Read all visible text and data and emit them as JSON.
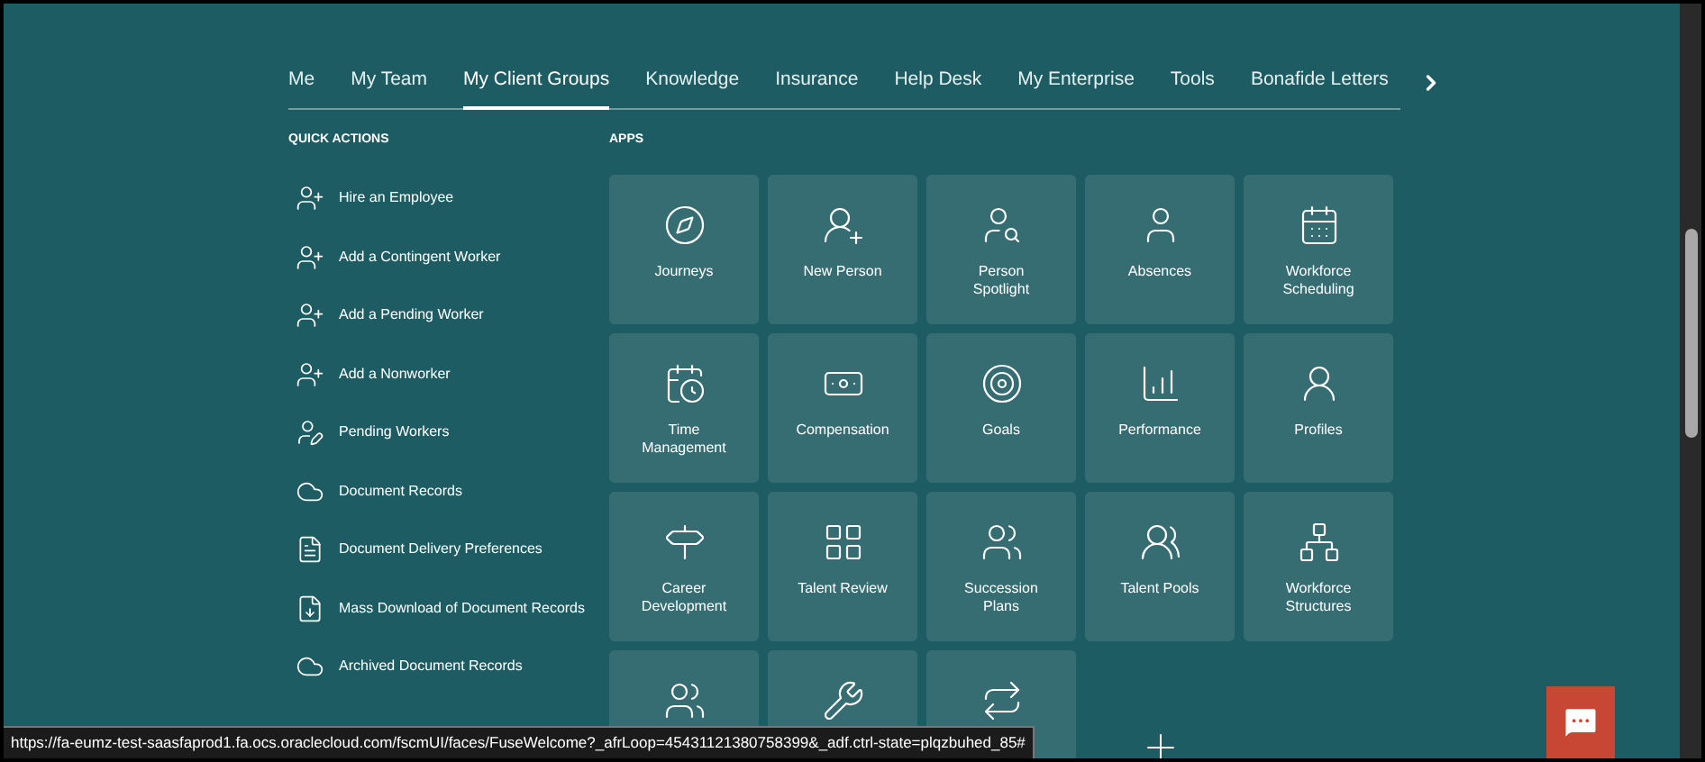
{
  "tabs": [
    {
      "label": "Me",
      "selected": false
    },
    {
      "label": "My Team",
      "selected": false
    },
    {
      "label": "My Client Groups",
      "selected": true
    },
    {
      "label": "Knowledge",
      "selected": false
    },
    {
      "label": "Insurance",
      "selected": false
    },
    {
      "label": "Help Desk",
      "selected": false
    },
    {
      "label": "My Enterprise",
      "selected": false
    },
    {
      "label": "Tools",
      "selected": false
    },
    {
      "label": "Bonafide Letters",
      "selected": false
    }
  ],
  "quick_actions": {
    "heading": "QUICK ACTIONS",
    "items": [
      {
        "label": "Hire an Employee"
      },
      {
        "label": "Add a Contingent Worker"
      },
      {
        "label": "Add a Pending Worker"
      },
      {
        "label": "Add a Nonworker"
      },
      {
        "label": "Pending Workers"
      },
      {
        "label": "Document Records"
      },
      {
        "label": "Document Delivery Preferences"
      },
      {
        "label": "Mass Download of Document Records"
      },
      {
        "label": "Archived Document Records"
      }
    ]
  },
  "apps": {
    "heading": "APPS",
    "tiles": [
      {
        "kind": "app",
        "label": "Journeys"
      },
      {
        "kind": "app",
        "label": "New Person"
      },
      {
        "kind": "app",
        "label": "Person Spotlight"
      },
      {
        "kind": "app",
        "label": "Absences"
      },
      {
        "kind": "app",
        "label": "Workforce Scheduling"
      },
      {
        "kind": "app",
        "label": "Time Management"
      },
      {
        "kind": "app",
        "label": "Compensation"
      },
      {
        "kind": "app",
        "label": "Goals"
      },
      {
        "kind": "app",
        "label": "Performance"
      },
      {
        "kind": "app",
        "label": "Profiles"
      },
      {
        "kind": "app",
        "label": "Career Development"
      },
      {
        "kind": "app",
        "label": "Talent Review"
      },
      {
        "kind": "app",
        "label": "Succession Plans"
      },
      {
        "kind": "app",
        "label": "Talent Pools"
      },
      {
        "kind": "app",
        "label": "Workforce Structures"
      },
      {
        "kind": "app"
      },
      {
        "kind": "app"
      },
      {
        "kind": "app"
      },
      {
        "kind": "add"
      }
    ]
  },
  "status_bar": {
    "url": "https://fa-eumz-test-saasfaprod1.fa.ocs.oraclecloud.com/fscmUI/faces/FuseWelcome?_afrLoop=45431121380758399&_adf.ctrl-state=plqzbuhed_85#"
  }
}
